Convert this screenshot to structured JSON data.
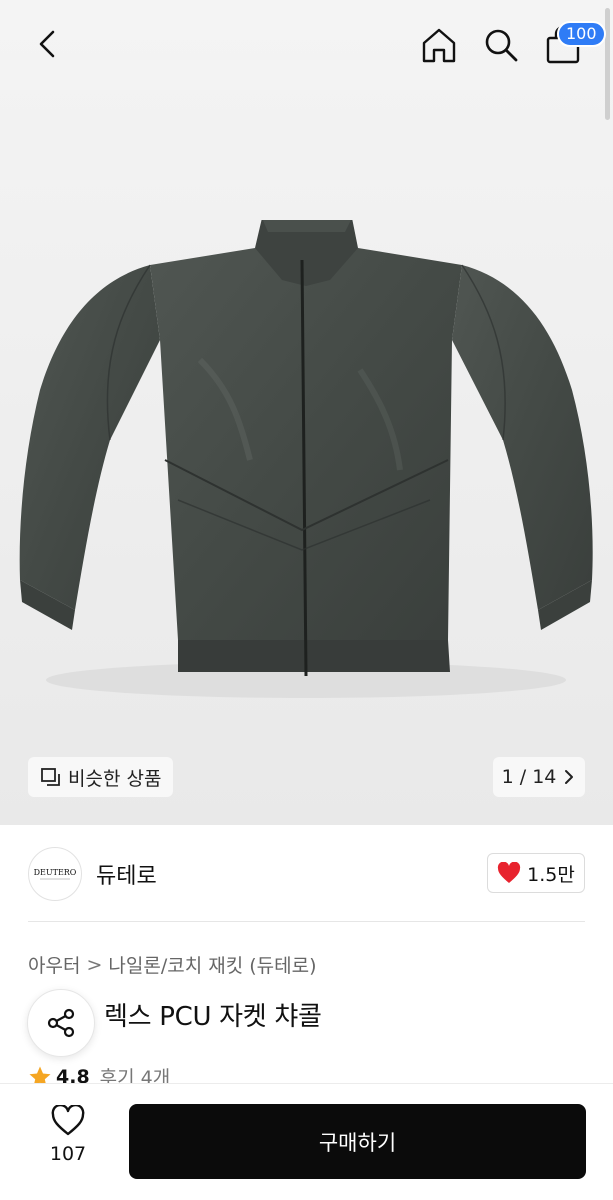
{
  "header": {
    "back_icon": "chevron-left-icon",
    "home_icon": "home-icon",
    "search_icon": "search-icon",
    "cart_icon": "shopping-bag-icon",
    "cart_badge": "100",
    "badge_color": "#2f7cf6"
  },
  "gallery": {
    "similar_label": "비슷한 상품",
    "similar_icon": "similar-items-icon",
    "page_indicator": "1 / 14",
    "page_icon": "chevron-right-icon"
  },
  "brand": {
    "logo_text": "DEUTERO",
    "name": "듀테로",
    "like_count": "1.5만",
    "like_icon": "heart-filled-icon",
    "like_color": "#e8232e"
  },
  "product": {
    "breadcrumb": [
      "아우터",
      "나일론/코치 재킷 (듀테로)"
    ],
    "breadcrumb_sep": ">",
    "title_visible": "렉스 PCU 자켓 챠콜",
    "share_icon": "share-icon",
    "rating_icon": "star-icon",
    "rating": "4.8",
    "review_text": "후기 4개"
  },
  "bottom_bar": {
    "wish_icon": "heart-outline-icon",
    "wish_count": "107",
    "buy_label": "구매하기"
  }
}
